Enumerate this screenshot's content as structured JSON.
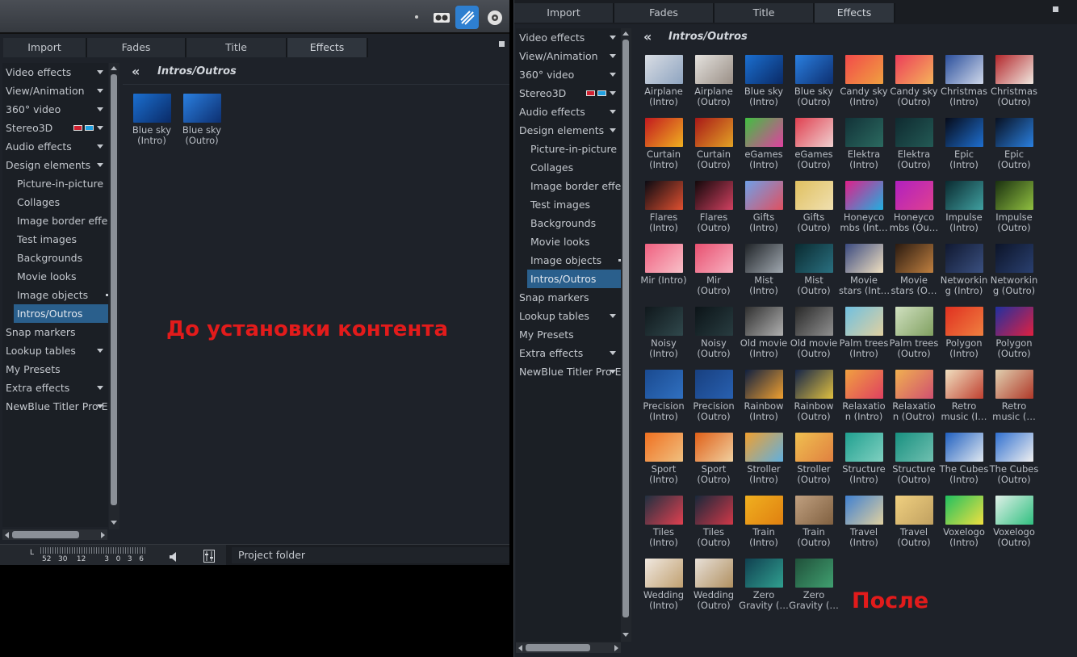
{
  "left": {
    "tabs": [
      "Import",
      "Fades",
      "Title",
      "Effects"
    ],
    "active_tab": 3,
    "sidebar": [
      {
        "label": "Video effects",
        "arrow": true
      },
      {
        "label": "View/Animation",
        "arrow": true
      },
      {
        "label": "360° video",
        "arrow": true
      },
      {
        "label": "Stereo3D",
        "arrow": true,
        "glasses": true
      },
      {
        "label": "Audio effects",
        "arrow": true
      },
      {
        "label": "Design elements",
        "arrow": true
      },
      {
        "label": "Picture-in-picture",
        "sub": true
      },
      {
        "label": "Collages",
        "sub": true
      },
      {
        "label": "Image border effects",
        "sub": true
      },
      {
        "label": "Test images",
        "sub": true
      },
      {
        "label": "Backgrounds",
        "sub": true
      },
      {
        "label": "Movie looks",
        "sub": true
      },
      {
        "label": "Image objects",
        "sub": true,
        "dot": true
      },
      {
        "label": "Intros/Outros",
        "sub": true,
        "selected": true
      },
      {
        "label": "Snap markers"
      },
      {
        "label": "Lookup tables",
        "arrow": true
      },
      {
        "label": "My Presets"
      },
      {
        "label": "Extra effects",
        "arrow": true
      },
      {
        "label": "NewBlue Titler Pro Ext",
        "arrow": true
      }
    ],
    "header": {
      "back": "«",
      "title": "Intros/Outros"
    },
    "items": [
      {
        "l1": "Blue sky",
        "l2": "(Intro)",
        "c1": "#1b6fd0",
        "c2": "#0a2a66"
      },
      {
        "l1": "Blue sky",
        "l2": "(Outro)",
        "c1": "#2a7fe0",
        "c2": "#0d2f70"
      }
    ],
    "overlay_text": "До установки контента",
    "meter": {
      "channel": "L",
      "scale": "52   30    12        3   0   3   6"
    },
    "project_folder": "Project folder"
  },
  "right": {
    "tabs": [
      "Import",
      "Fades",
      "Title",
      "Effects"
    ],
    "active_tab": 3,
    "sidebar": [
      {
        "label": "Video effects",
        "arrow": true
      },
      {
        "label": "View/Animation",
        "arrow": true
      },
      {
        "label": "360° video",
        "arrow": true
      },
      {
        "label": "Stereo3D",
        "arrow": true,
        "glasses": true
      },
      {
        "label": "Audio effects",
        "arrow": true
      },
      {
        "label": "Design elements",
        "arrow": true
      },
      {
        "label": "Picture-in-picture",
        "sub": true
      },
      {
        "label": "Collages",
        "sub": true
      },
      {
        "label": "Image border effects",
        "sub": true
      },
      {
        "label": "Test images",
        "sub": true
      },
      {
        "label": "Backgrounds",
        "sub": true
      },
      {
        "label": "Movie looks",
        "sub": true
      },
      {
        "label": "Image objects",
        "sub": true,
        "dot": true
      },
      {
        "label": "Intros/Outros",
        "sub": true,
        "selected": true
      },
      {
        "label": "Snap markers"
      },
      {
        "label": "Lookup tables",
        "arrow": true
      },
      {
        "label": "My Presets"
      },
      {
        "label": "Extra effects",
        "arrow": true
      },
      {
        "label": "NewBlue Titler Pro Ext",
        "arrow": true
      }
    ],
    "header": {
      "back": "«",
      "title": "Intros/Outros"
    },
    "items": [
      {
        "l1": "Airplane",
        "l2": "(Intro)",
        "c1": "#d9dde4",
        "c2": "#8ea4c0"
      },
      {
        "l1": "Airplane",
        "l2": "(Outro)",
        "c1": "#e4e2de",
        "c2": "#9a8f86"
      },
      {
        "l1": "Blue sky",
        "l2": "(Intro)",
        "c1": "#1b6fd0",
        "c2": "#0a2a66"
      },
      {
        "l1": "Blue sky",
        "l2": "(Outro)",
        "c1": "#2a7fe0",
        "c2": "#0d2f70"
      },
      {
        "l1": "Candy sky",
        "l2": "(Intro)",
        "c1": "#f24a4a",
        "c2": "#f0a040"
      },
      {
        "l1": "Candy sky",
        "l2": "(Outro)",
        "c1": "#ec3d5a",
        "c2": "#f5b35a"
      },
      {
        "l1": "Christmas",
        "l2": "(Intro)",
        "c1": "#2b4f9c",
        "c2": "#cfd8ea"
      },
      {
        "l1": "Christmas",
        "l2": "(Outro)",
        "c1": "#b3262b",
        "c2": "#f0e8e0"
      },
      {
        "l1": "Curtain",
        "l2": "(Intro)",
        "c1": "#c2191f",
        "c2": "#f0b020"
      },
      {
        "l1": "Curtain",
        "l2": "(Outro)",
        "c1": "#a81818",
        "c2": "#e3a325"
      },
      {
        "l1": "eGames",
        "l2": "(Intro)",
        "c1": "#40c040",
        "c2": "#e040a0"
      },
      {
        "l1": "eGames",
        "l2": "(Outro)",
        "c1": "#e04050",
        "c2": "#f0d0d0"
      },
      {
        "l1": "Elektra",
        "l2": "(Intro)",
        "c1": "#123238",
        "c2": "#2b6a60"
      },
      {
        "l1": "Elektra",
        "l2": "(Outro)",
        "c1": "#0f2a30",
        "c2": "#235a55"
      },
      {
        "l1": "Epic",
        "l2": "(Intro)",
        "c1": "#060a18",
        "c2": "#1e6fd0"
      },
      {
        "l1": "Epic",
        "l2": "(Outro)",
        "c1": "#081020",
        "c2": "#2a80e0"
      },
      {
        "l1": "Flares",
        "l2": "(Intro)",
        "c1": "#0a0a12",
        "c2": "#e05030"
      },
      {
        "l1": "Flares",
        "l2": "(Outro)",
        "c1": "#12080a",
        "c2": "#d04060"
      },
      {
        "l1": "Gifts",
        "l2": "(Intro)",
        "c1": "#6fa0e8",
        "c2": "#e05060"
      },
      {
        "l1": "Gifts",
        "l2": "(Outro)",
        "c1": "#e0c060",
        "c2": "#f0e0b0"
      },
      {
        "l1": "Honeyco",
        "l2": "mbs (Int…",
        "c1": "#e0208a",
        "c2": "#20b0e0"
      },
      {
        "l1": "Honeyco",
        "l2": "mbs (Ou…",
        "c1": "#b020c0",
        "c2": "#e04090"
      },
      {
        "l1": "Impulse",
        "l2": "(Intro)",
        "c1": "#0a2a30",
        "c2": "#40a0a0"
      },
      {
        "l1": "Impulse",
        "l2": "(Outro)",
        "c1": "#1a3010",
        "c2": "#90c040"
      },
      {
        "l1": "Mir (Intro)",
        "l2": "",
        "c1": "#f06080",
        "c2": "#f8c0c8"
      },
      {
        "l1": "Mir",
        "l2": "(Outro)",
        "c1": "#e85070",
        "c2": "#f8b0c0"
      },
      {
        "l1": "Mist",
        "l2": "(Intro)",
        "c1": "#202428",
        "c2": "#a0a8b0"
      },
      {
        "l1": "Mist",
        "l2": "(Outro)",
        "c1": "#0a2a30",
        "c2": "#2a7080"
      },
      {
        "l1": "Movie",
        "l2": "stars (Int…",
        "c1": "#3a4a80",
        "c2": "#f0e0c0"
      },
      {
        "l1": "Movie",
        "l2": "stars (O…",
        "c1": "#2a1a10",
        "c2": "#c08040"
      },
      {
        "l1": "Networkin",
        "l2": "g (Intro)",
        "c1": "#101830",
        "c2": "#3a5080"
      },
      {
        "l1": "Networkin",
        "l2": "g (Outro)",
        "c1": "#0c1428",
        "c2": "#2a4070"
      },
      {
        "l1": "Noisy",
        "l2": "(Intro)",
        "c1": "#10181c",
        "c2": "#30484c"
      },
      {
        "l1": "Noisy",
        "l2": "(Outro)",
        "c1": "#0c1418",
        "c2": "#283c40"
      },
      {
        "l1": "Old movie",
        "l2": "(Intro)",
        "c1": "#303030",
        "c2": "#b0b0b0"
      },
      {
        "l1": "Old movie",
        "l2": "(Outro)",
        "c1": "#282828",
        "c2": "#909090"
      },
      {
        "l1": "Palm trees",
        "l2": "(Intro)",
        "c1": "#70c0e0",
        "c2": "#e0d0a0"
      },
      {
        "l1": "Palm trees",
        "l2": "(Outro)",
        "c1": "#d0e0c0",
        "c2": "#80a060"
      },
      {
        "l1": "Polygon",
        "l2": "(Intro)",
        "c1": "#e03020",
        "c2": "#f08040"
      },
      {
        "l1": "Polygon",
        "l2": "(Outro)",
        "c1": "#2030a0",
        "c2": "#e02040"
      },
      {
        "l1": "Precision",
        "l2": "(Intro)",
        "c1": "#1a4a90",
        "c2": "#3070c0"
      },
      {
        "l1": "Precision",
        "l2": "(Outro)",
        "c1": "#184080",
        "c2": "#2860b0"
      },
      {
        "l1": "Rainbow",
        "l2": "(Intro)",
        "c1": "#102040",
        "c2": "#f0a030"
      },
      {
        "l1": "Rainbow",
        "l2": "(Outro)",
        "c1": "#142448",
        "c2": "#e0c040"
      },
      {
        "l1": "Relaxatio",
        "l2": "n (Intro)",
        "c1": "#f0a040",
        "c2": "#e04060"
      },
      {
        "l1": "Relaxatio",
        "l2": "n (Outro)",
        "c1": "#f0b050",
        "c2": "#d05070"
      },
      {
        "l1": "Retro",
        "l2": "music (I…",
        "c1": "#f0e0c0",
        "c2": "#c04030"
      },
      {
        "l1": "Retro",
        "l2": "music (…",
        "c1": "#e0d0b0",
        "c2": "#b03828"
      },
      {
        "l1": "Sport",
        "l2": "(Intro)",
        "c1": "#f07020",
        "c2": "#f0c080"
      },
      {
        "l1": "Sport",
        "l2": "(Outro)",
        "c1": "#e06018",
        "c2": "#f0d0a0"
      },
      {
        "l1": "Stroller",
        "l2": "(Intro)",
        "c1": "#f0a030",
        "c2": "#60b0e0"
      },
      {
        "l1": "Stroller",
        "l2": "(Outro)",
        "c1": "#f0c050",
        "c2": "#e08040"
      },
      {
        "l1": "Structure",
        "l2": "(Intro)",
        "c1": "#20a090",
        "c2": "#80d0c0"
      },
      {
        "l1": "Structure",
        "l2": "(Outro)",
        "c1": "#189080",
        "c2": "#70c0b0"
      },
      {
        "l1": "The Cubes",
        "l2": "(Intro)",
        "c1": "#2060c0",
        "c2": "#e0e8f0"
      },
      {
        "l1": "The Cubes",
        "l2": "(Outro)",
        "c1": "#3070d0",
        "c2": "#f0f0f0"
      },
      {
        "l1": "Tiles",
        "l2": "(Intro)",
        "c1": "#203040",
        "c2": "#e04050"
      },
      {
        "l1": "Tiles",
        "l2": "(Outro)",
        "c1": "#18283a",
        "c2": "#d03848"
      },
      {
        "l1": "Train",
        "l2": "(Intro)",
        "c1": "#f0b020",
        "c2": "#e08010"
      },
      {
        "l1": "Train",
        "l2": "(Outro)",
        "c1": "#c0a080",
        "c2": "#806040"
      },
      {
        "l1": "Travel",
        "l2": "(Intro)",
        "c1": "#4080d0",
        "c2": "#e0d0a0"
      },
      {
        "l1": "Travel",
        "l2": "(Outro)",
        "c1": "#f0d080",
        "c2": "#c0a060"
      },
      {
        "l1": "Voxelogo",
        "l2": "(Intro)",
        "c1": "#20c060",
        "c2": "#f0e040"
      },
      {
        "l1": "Voxelogo",
        "l2": "(Outro)",
        "c1": "#e0f0e8",
        "c2": "#30c080"
      },
      {
        "l1": "Wedding",
        "l2": "(Intro)",
        "c1": "#f0e8e0",
        "c2": "#c0a070"
      },
      {
        "l1": "Wedding",
        "l2": "(Outro)",
        "c1": "#e8e0d8",
        "c2": "#b09060"
      },
      {
        "l1": "Zero",
        "l2": "Gravity (…",
        "c1": "#104050",
        "c2": "#30a090"
      },
      {
        "l1": "Zero",
        "l2": "Gravity (…",
        "c1": "#20503a",
        "c2": "#40a070"
      }
    ],
    "overlay_text": "После"
  }
}
